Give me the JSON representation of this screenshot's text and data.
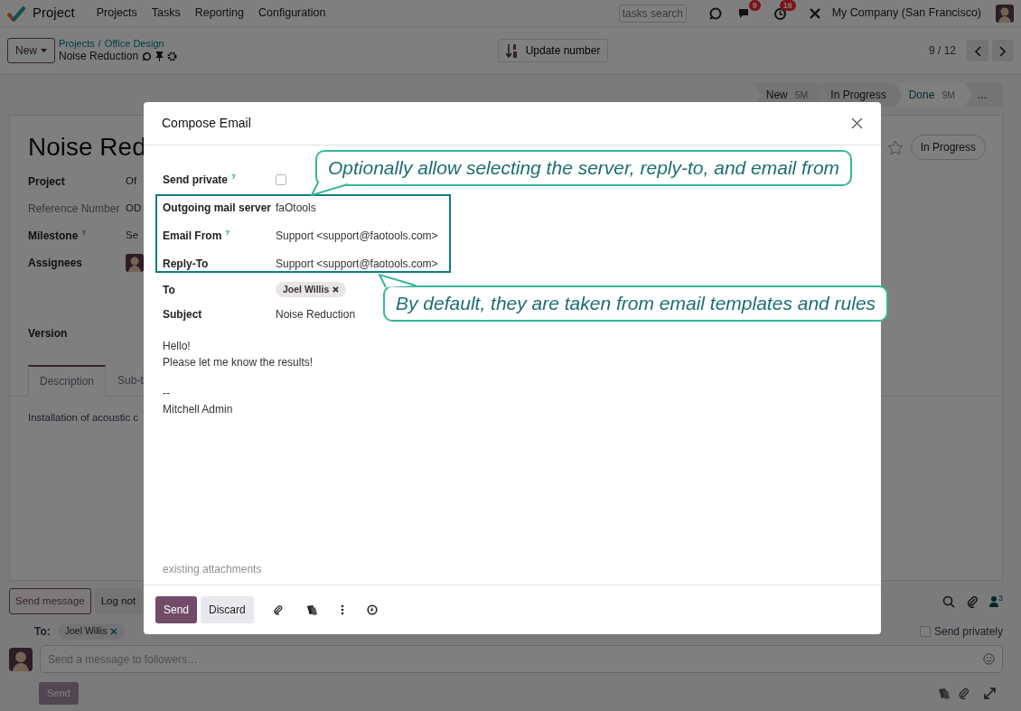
{
  "navbar": {
    "app": "Project",
    "menu": [
      "Projects",
      "Tasks",
      "Reporting",
      "Configuration"
    ],
    "search_placeholder": "tasks search",
    "messages_count": "9",
    "activities_count": "16",
    "company": "My Company (San Francisco)"
  },
  "control_panel": {
    "new_button": "New",
    "breadcrumbs": [
      "Projects",
      "Office Design"
    ],
    "separator": "/",
    "record": "Noise Reduction",
    "action_button": "Update number",
    "pager": "9 / 12"
  },
  "stages": [
    {
      "label": "New",
      "duration": "5M",
      "selected": false
    },
    {
      "label": "In Progress",
      "selected": false
    },
    {
      "label": "Done",
      "duration": "9M",
      "selected": true
    }
  ],
  "stages_more": "...",
  "task": {
    "title": "Noise Red",
    "status": "In Progress",
    "fields": [
      {
        "label": "Project",
        "value": "Of",
        "kind": "text"
      },
      {
        "label": "Reference Number",
        "value": "OD",
        "kind": "muted"
      },
      {
        "label": "Milestone",
        "help": "?",
        "value": "Se",
        "kind": "text"
      },
      {
        "label": "Assignees",
        "kind": "avatar"
      },
      {
        "label": "Version",
        "kind": "empty"
      }
    ],
    "tabs": [
      {
        "label": "Description",
        "selected": true
      },
      {
        "label": "Sub-t",
        "selected": false
      }
    ],
    "description": "Installation of acoustic c"
  },
  "chatter": {
    "buttons": [
      {
        "label": "Send message",
        "selected": true
      },
      {
        "label": "Log not",
        "selected": false
      }
    ],
    "followers_count": "3",
    "to_label": "To:",
    "recipient": "Joel Willis",
    "send_privately": {
      "label": "Send privately",
      "checked": false
    },
    "placeholder": "Send a message to followers…",
    "send": "Send"
  },
  "dialog": {
    "title": "Compose Email",
    "fields": [
      {
        "label": "Send private",
        "help": "?",
        "kind": "checkbox",
        "checked": false
      },
      {
        "label": "Outgoing mail server",
        "kind": "text",
        "value": "faOtools"
      },
      {
        "label": "Email From",
        "help": "?",
        "kind": "text",
        "value": "Support <support@faotools.com>"
      },
      {
        "label": "Reply-To",
        "kind": "text",
        "value": "Support <support@faotools.com>"
      },
      {
        "label": "To",
        "kind": "tags",
        "tags": [
          "Joel Willis"
        ]
      },
      {
        "label": "Subject",
        "kind": "text",
        "value": "Noise Reduction"
      }
    ],
    "body": [
      [
        "Hello!",
        "Please let me know the results!"
      ],
      [
        "--",
        "Mitchell Admin"
      ]
    ],
    "attachments": "existing attachments",
    "buttons": [
      {
        "label": "Send",
        "kind": "primary"
      },
      {
        "label": "Discard",
        "kind": "secondary"
      }
    ]
  },
  "callouts": [
    {
      "text": "Optionally allow selecting the server, reply-to, and email from"
    },
    {
      "text": "By default, they are taken from email templates and rules"
    }
  ]
}
